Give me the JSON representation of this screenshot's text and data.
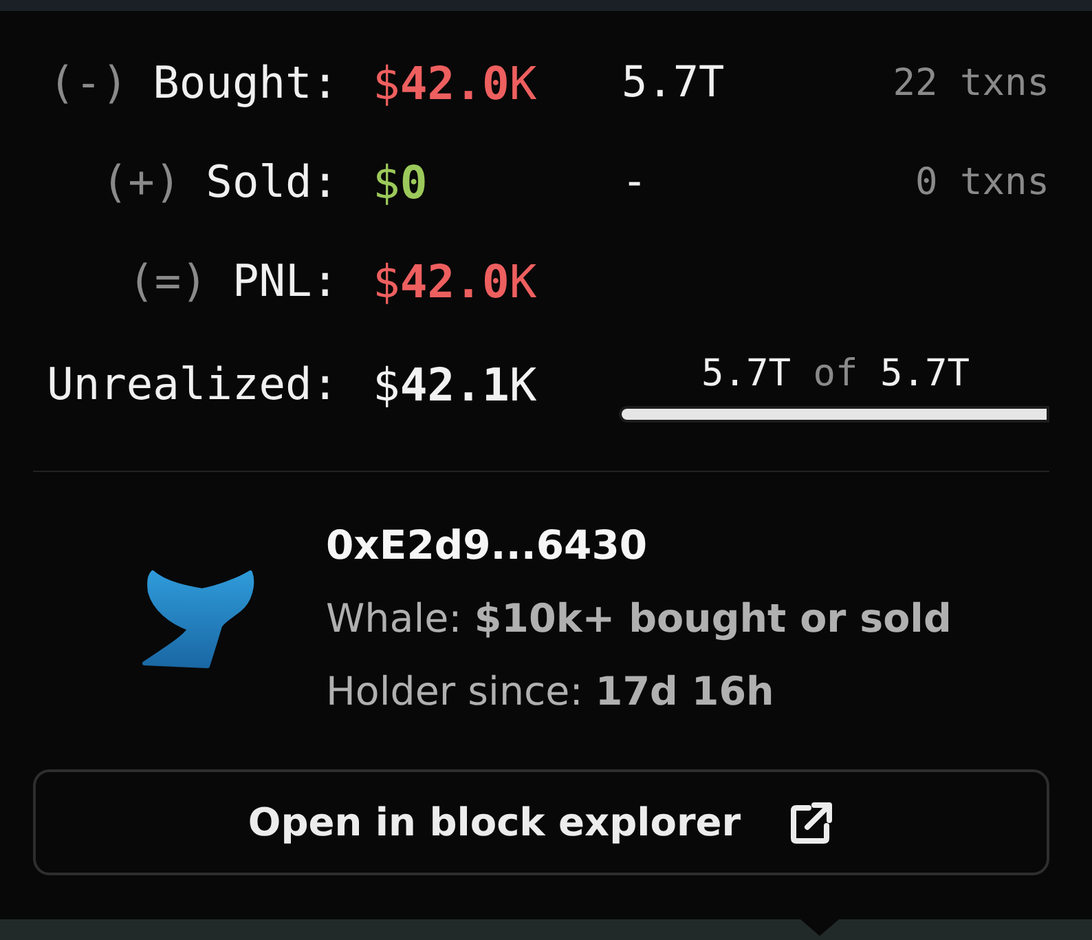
{
  "stats": {
    "rows": [
      {
        "kind": "trade",
        "sign": "(-)",
        "label": "Bought:",
        "value": "$**42.0**K",
        "color": "#ee5f5f",
        "amount": "5.7T",
        "txns": "22 txns"
      },
      {
        "kind": "trade",
        "sign": "(+)",
        "label": "Sold:",
        "value": "$**0**",
        "color": "#9cc95b",
        "amount": "-",
        "txns": "0 txns"
      },
      {
        "kind": "total",
        "sign": "(=)",
        "label": "PNL:",
        "value": "$**42.0**K",
        "color": "#ee5f5f"
      },
      {
        "kind": "holding",
        "label": "Unrealized:",
        "value": "$**42.1**K",
        "color": "#f2f2f2",
        "held": "5.7T",
        "of": "of",
        "total": "5.7T",
        "level": 1
      }
    ]
  },
  "holder": {
    "address": "0xE2d9...6430",
    "tags": [
      "Whale: **$10k+ bought or sold**",
      "Holder since: **17d 16h**"
    ]
  },
  "button": {
    "label": "Open in block explorer"
  }
}
